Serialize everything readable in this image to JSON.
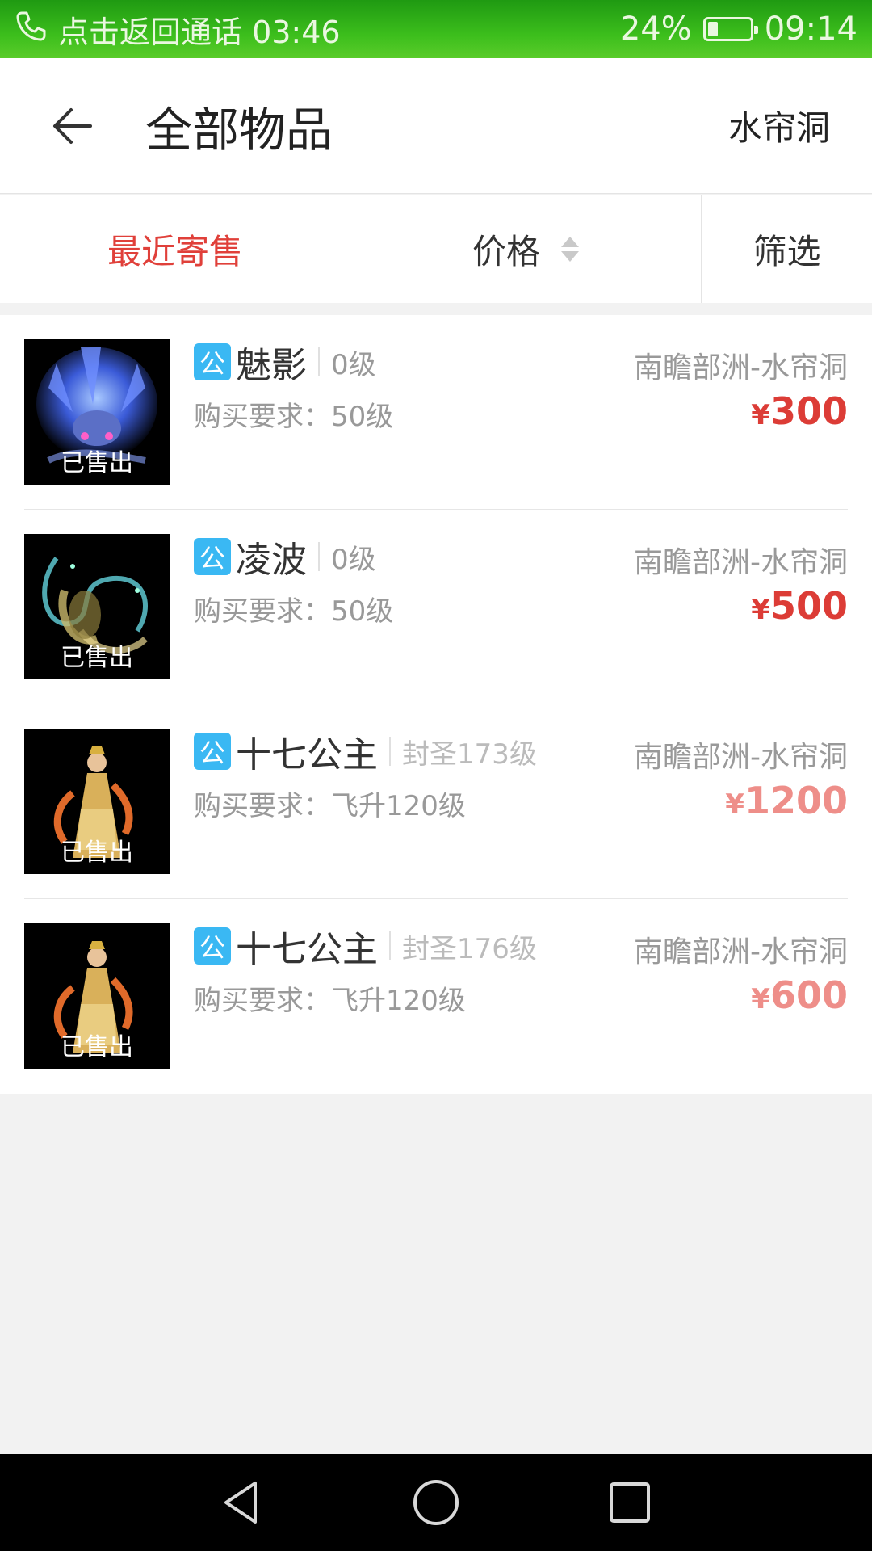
{
  "status_bar": {
    "call_text": "点击返回通话 03:46",
    "battery_percent": "24%",
    "battery_level": 0.24,
    "time": "09:14"
  },
  "header": {
    "title": "全部物品",
    "location": "水帘洞"
  },
  "sortbar": {
    "recent": "最近寄售",
    "price": "价格",
    "filter": "筛选"
  },
  "items": [
    {
      "badge": "公",
      "name": "魅影",
      "level": "0级",
      "requirement": "购买要求：50级",
      "region": "南瞻部洲-水帘洞",
      "currency": "¥",
      "price": "300",
      "status": "已售出",
      "image": "mount-blue-dragon"
    },
    {
      "badge": "公",
      "name": "凌波",
      "level": "0级",
      "requirement": "购买要求：50级",
      "region": "南瞻部洲-水帘洞",
      "currency": "¥",
      "price": "500",
      "status": "已售出",
      "image": "mount-ribbon-spirit"
    },
    {
      "badge": "公",
      "name": "十七公主",
      "level": "封圣173级",
      "requirement": "购买要求：飞升120级",
      "region": "南瞻部洲-水帘洞",
      "currency": "¥",
      "price": "1200",
      "status": "已售出",
      "image": "princess-character"
    },
    {
      "badge": "公",
      "name": "十七公主",
      "level": "封圣176级",
      "requirement": "购买要求：飞升120级",
      "region": "南瞻部洲-水帘洞",
      "currency": "¥",
      "price": "600",
      "status": "已售出",
      "image": "princess-character"
    }
  ],
  "colors": {
    "accent_red": "#e0403a",
    "badge_blue": "#3ab8f3",
    "status_green": "#3cbe1c"
  },
  "icons": {
    "back": "arrow-left-icon",
    "phone": "phone-icon",
    "battery": "battery-icon",
    "sort": "sort-arrows-icon",
    "nav_back": "triangle-back-icon",
    "nav_home": "circle-home-icon",
    "nav_recent": "square-recent-icon"
  }
}
